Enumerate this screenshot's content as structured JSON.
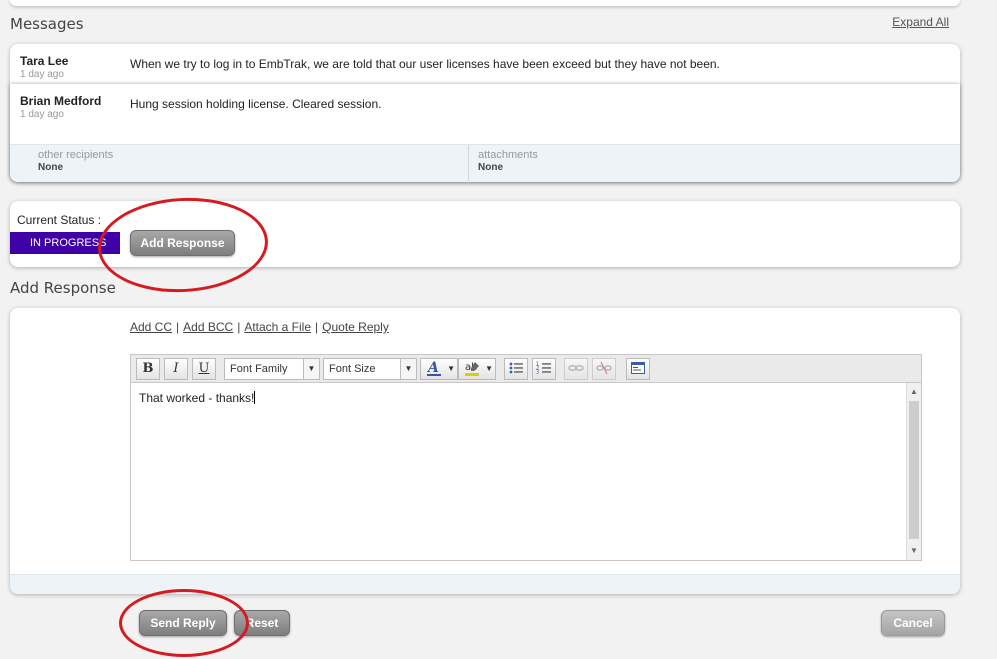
{
  "messages_section": {
    "title": "Messages",
    "expand_all": "Expand All",
    "items": [
      {
        "author": "Tara Lee",
        "time": "1 day ago",
        "body": "When we try to log in to EmbTrak, we are told that our user licenses have been exceed but they have not been."
      },
      {
        "author": "Brian Medford",
        "time": "1 day ago",
        "body": "Hung session holding license.  Cleared session."
      }
    ],
    "other_recipients_label": "other recipients",
    "other_recipients_value": "None",
    "attachments_label": "attachments",
    "attachments_value": "None"
  },
  "status": {
    "label": "Current Status :",
    "value": "IN PROGRESS",
    "color": "#4000a8",
    "add_response_button": "Add Response"
  },
  "response_section": {
    "title": "Add Response",
    "links": [
      "Add CC",
      "Add BCC",
      "Attach a File",
      "Quote Reply"
    ],
    "toolbar": {
      "bold": "B",
      "italic": "I",
      "underline": "U",
      "font_family": "Font Family",
      "font_size": "Font Size",
      "icons": [
        "font-color-icon",
        "highlight-icon",
        "bullet-list-icon",
        "numbered-list-icon",
        "link-icon",
        "unlink-icon",
        "source-code-icon"
      ]
    },
    "editor_text": "That worked - thanks!"
  },
  "actions": {
    "send_reply": "Send Reply",
    "reset": "Reset",
    "cancel": "Cancel"
  },
  "annotation_color": "#d71920"
}
